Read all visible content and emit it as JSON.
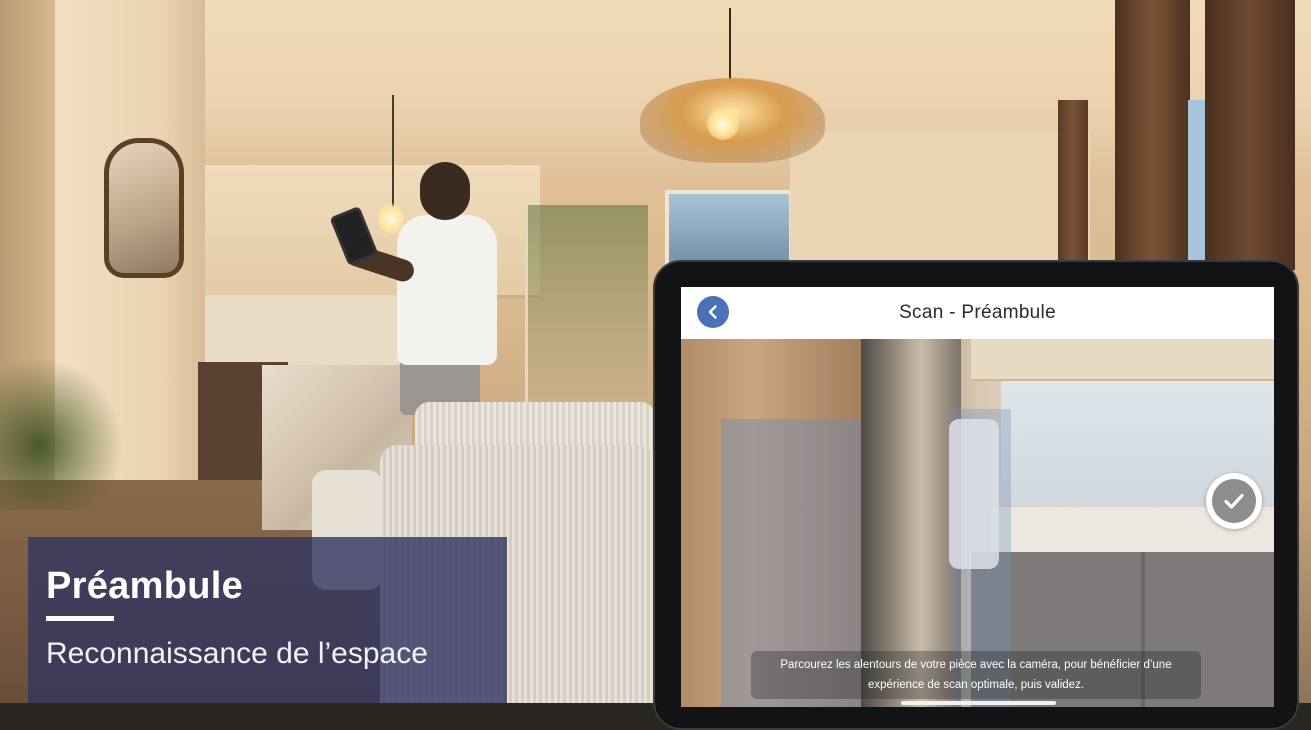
{
  "caption": {
    "title": "Préambule",
    "subtitle": "Reconnaissance de l’espace"
  },
  "app": {
    "title": "Scan - Préambule",
    "back_icon": "chevron-left-icon",
    "validate_icon": "checkmark-icon",
    "hint": "Parcourez les alentours de votre pièce avec la caméra, pour bénéficier d’une expérience de scan optimale, puis validez."
  },
  "colors": {
    "caption_bg": "#32346a",
    "accent_blue": "#4b72b8",
    "validate_gray": "#8d8d8d"
  }
}
